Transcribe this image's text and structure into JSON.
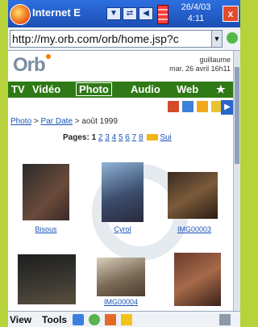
{
  "window": {
    "app_title": "Internet E",
    "date": "26/4/03",
    "time": "4:11",
    "close_label": "x"
  },
  "address": {
    "url": "http://my.orb.com/orb/home.jsp?c"
  },
  "site": {
    "logo": "Orb",
    "user_name": "guillaume",
    "user_date": "mar. 26 avril 16h11"
  },
  "nav": {
    "items": [
      "TV",
      "Vidéo",
      "Photo",
      "Audio",
      "Web",
      "★"
    ],
    "active": "Photo"
  },
  "breadcrumb": {
    "root": "Photo",
    "sep1": " > ",
    "by_date": "Par Date",
    "sep2": " > ",
    "current": "août 1999"
  },
  "pagination": {
    "label": "Pages:",
    "current": "1",
    "pages": [
      "2",
      "3",
      "4",
      "5",
      "6",
      "7",
      "8"
    ],
    "next": "Sui"
  },
  "photos": [
    {
      "caption": "Bisous"
    },
    {
      "caption": "Cyrol"
    },
    {
      "caption": "IMG00003"
    },
    {
      "caption": ""
    },
    {
      "caption": "IMG00004"
    },
    {
      "caption": ""
    }
  ],
  "bottom": {
    "view": "View",
    "tools": "Tools"
  },
  "colors": {
    "navbar": "#2f7a16",
    "link": "#1a52b5",
    "titlebar": "#1c4fb4"
  }
}
